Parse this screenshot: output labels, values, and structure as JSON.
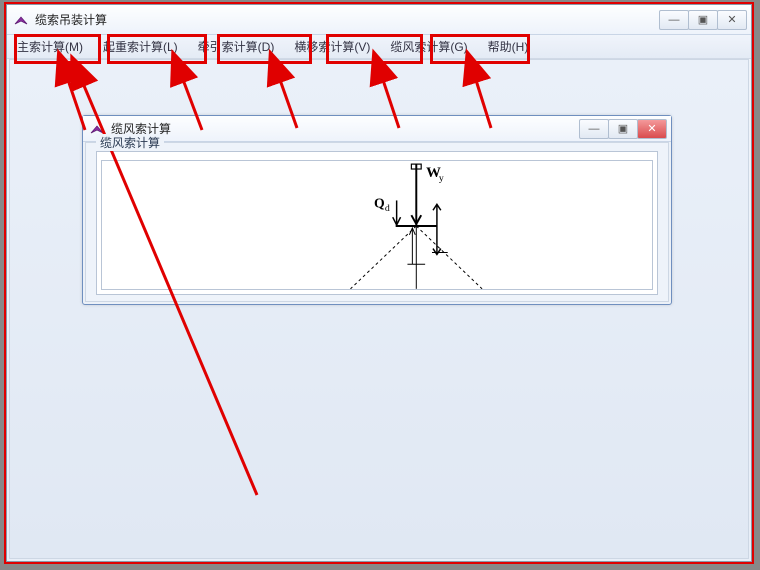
{
  "main_window": {
    "title": "缆索吊装计算",
    "controls": {
      "min": "—",
      "max": "▣",
      "close": "✕"
    }
  },
  "menubar": {
    "items": [
      {
        "label": "主索计算(M)"
      },
      {
        "label": "起重索计算(L)"
      },
      {
        "label": "牵引索计算(D)"
      },
      {
        "label": "横移索计算(V)"
      },
      {
        "label": "缆风索计算(G)"
      },
      {
        "label": "帮助(H)"
      }
    ]
  },
  "child_window": {
    "title": "缆风索计算",
    "controls": {
      "min": "—",
      "max": "▣",
      "close": "✕"
    },
    "group_label": "缆风索计算",
    "diagram_labels": {
      "wy": "Wy",
      "qd": "Qd"
    }
  }
}
